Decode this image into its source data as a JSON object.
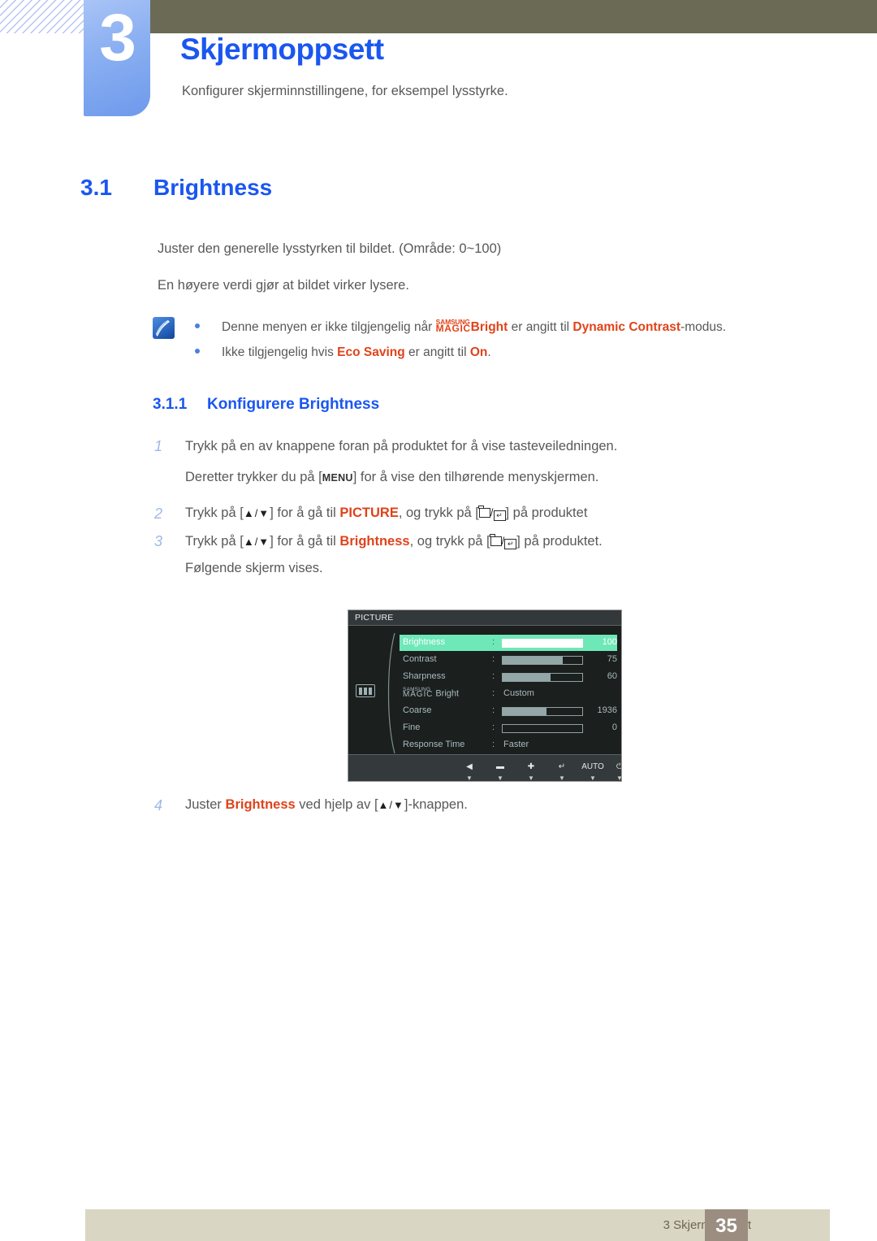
{
  "header": {
    "chapter_number": "3",
    "chapter_title": "Skjermoppsett",
    "chapter_subtitle": "Konfigurer skjerminnstillingene, for eksempel lysstyrke."
  },
  "section": {
    "number": "3.1",
    "title": "Brightness"
  },
  "body": {
    "paragraph_range": "Juster den generelle lysstyrken til bildet. (Område: 0~100)",
    "paragraph_higher": "En høyere verdi gjør at bildet virker lysere."
  },
  "note": {
    "icon": "note-pen-icon",
    "row1": {
      "pre": "Denne menyen er ikke tilgjengelig når ",
      "magic_top": "SAMSUNG",
      "magic_bottom": "MAGIC",
      "magic_suffix": "Bright",
      "mid": " er angitt til ",
      "highlight": "Dynamic Contrast",
      "post": "-modus."
    },
    "row2": {
      "pre": "Ikke tilgjengelig hvis ",
      "highlight1": "Eco Saving",
      "mid": " er angitt til ",
      "highlight2": "On",
      "post": "."
    }
  },
  "subsection": {
    "number": "3.1.1",
    "title": "Konfigurere Brightness"
  },
  "steps": {
    "step1": {
      "num": "1",
      "text": "Trykk på en av knappene foran på produktet for å vise tasteveiledningen.",
      "sub_pre": "Deretter trykker du på [",
      "sub_key": "MENU",
      "sub_post": "] for å vise den tilhørende menyskjermen."
    },
    "step2": {
      "num": "2",
      "pre": "Trykk på [",
      "keys": "▲/▼",
      "mid": "] for å gå til ",
      "highlight": "PICTURE",
      "mid2": ", og trykk på [",
      "post": "] på produktet"
    },
    "step3": {
      "num": "3",
      "pre": "Trykk på [",
      "keys": "▲/▼",
      "mid": "] for å gå til ",
      "highlight": "Brightness",
      "mid2": ", og trykk på [",
      "post": "] på produktet.",
      "sub": "Følgende skjerm vises."
    },
    "step4": {
      "num": "4",
      "pre": "Juster ",
      "highlight": "Brightness",
      "mid": " ved hjelp av [",
      "keys": "▲/▼",
      "post": "]-knappen."
    }
  },
  "osd": {
    "title": "PICTURE",
    "left_icon": "picture-bars-icon",
    "scroll_down_marker": "▼",
    "rows": [
      {
        "label": "Brightness",
        "colon": ":",
        "type": "bar",
        "percent": 100,
        "value": "100",
        "selected": true
      },
      {
        "label": "Contrast",
        "colon": ":",
        "type": "bar",
        "percent": 75,
        "value": "75",
        "selected": false
      },
      {
        "label": "Sharpness",
        "colon": ":",
        "type": "bar",
        "percent": 60,
        "value": "60",
        "selected": false
      },
      {
        "label": "MAGIC Bright",
        "colon": ":",
        "type": "text",
        "value": "Custom",
        "selected": false,
        "magic_top": "SAMSUNG",
        "magic_bottom": "MAGIC",
        "magic_suffix": " Bright"
      },
      {
        "label": "Coarse",
        "colon": ":",
        "type": "bar",
        "percent": 55,
        "value": "1936",
        "selected": false
      },
      {
        "label": "Fine",
        "colon": ":",
        "type": "bar",
        "percent": 0,
        "value": "0",
        "selected": false
      },
      {
        "label": "Response Time",
        "colon": ":",
        "type": "text",
        "value": "Faster",
        "selected": false
      }
    ],
    "toolbar": [
      {
        "name": "back",
        "glyph": "◀",
        "caret": "▼"
      },
      {
        "name": "minus",
        "glyph": "▬",
        "caret": "▼"
      },
      {
        "name": "plus",
        "glyph": "✚",
        "caret": "▼"
      },
      {
        "name": "enter",
        "glyph": "↵",
        "caret": "▼"
      },
      {
        "name": "auto",
        "label": "AUTO",
        "caret": "▼"
      },
      {
        "name": "power",
        "glyph": "⏻",
        "caret": "▼"
      }
    ]
  },
  "footer": {
    "text": "3 Skjermoppsett",
    "page_number": "35"
  },
  "colors": {
    "accent_blue": "#1a56f0",
    "highlight_orange": "#e0431a",
    "olive_bar": "#6b6b55",
    "footer_beige": "#d9d6c3",
    "page_box": "#9b8e80",
    "osd_selected": "#6fe8b8"
  }
}
